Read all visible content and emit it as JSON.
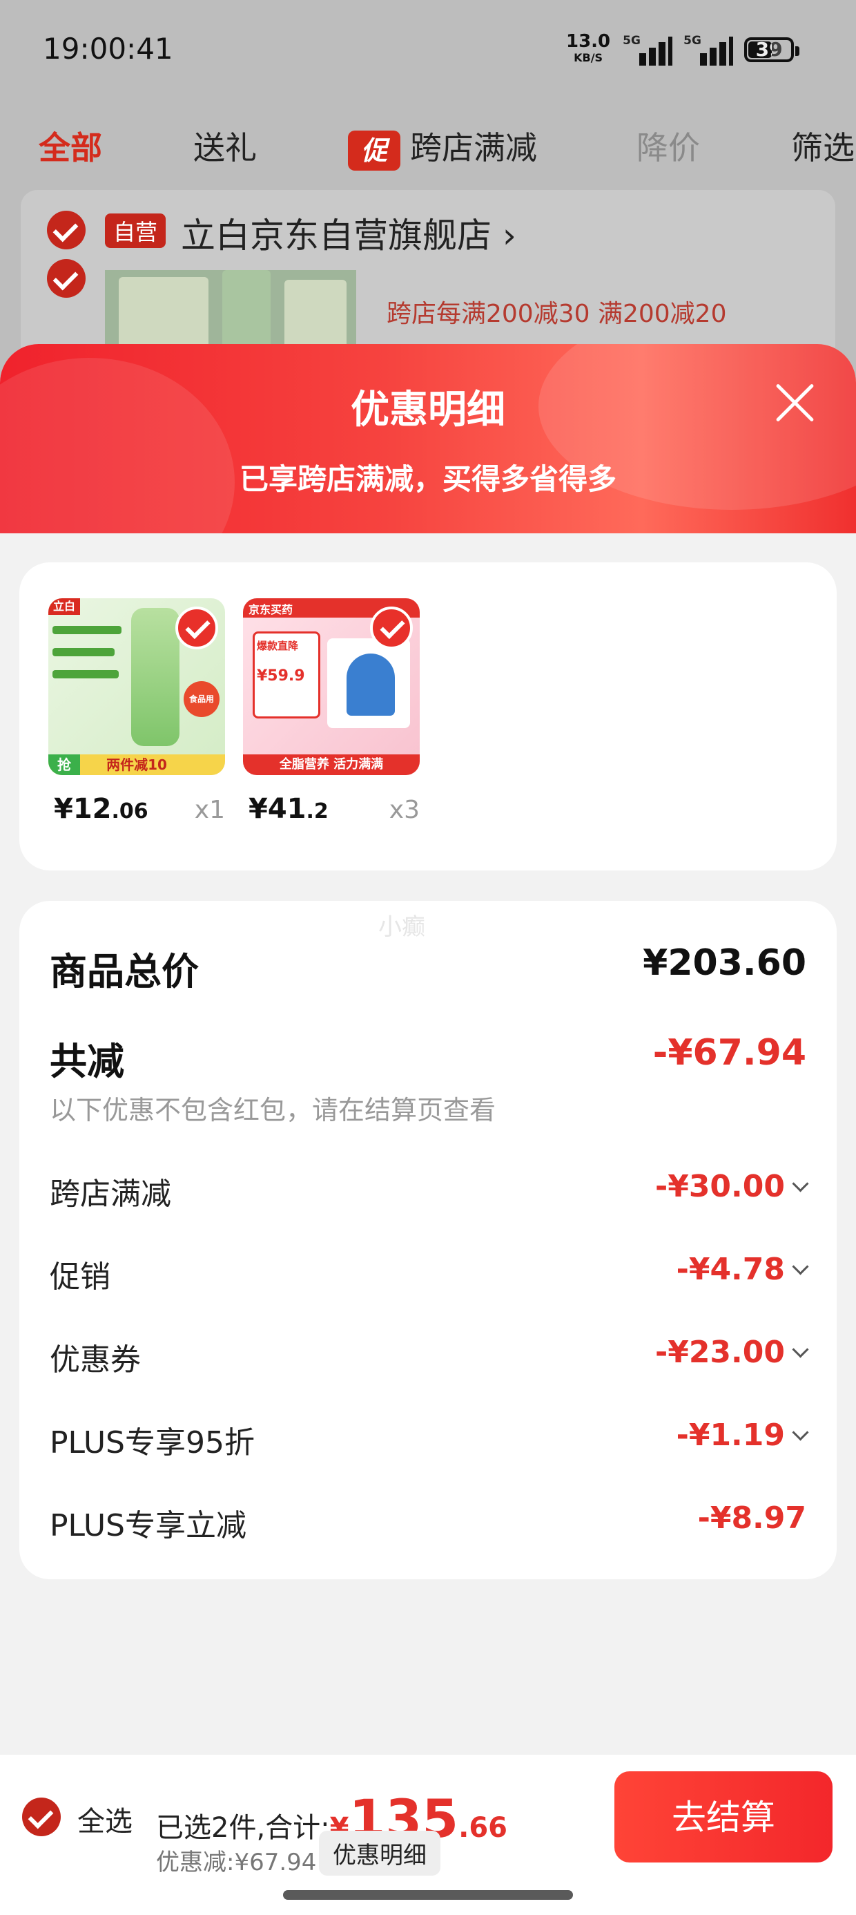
{
  "status_bar": {
    "time": "19:00:41",
    "net_speed": "13.0",
    "net_unit": "KB/S",
    "sig1": "5G",
    "sig2": "5G",
    "battery": "39"
  },
  "tabs": [
    {
      "label": "全部"
    },
    {
      "label": "送礼"
    },
    {
      "badge": "促",
      "label": "跨店满减"
    },
    {
      "label": "降价"
    },
    {
      "label": "筛选"
    }
  ],
  "store": {
    "self_tag": "自营",
    "name": "立白京东自营旗舰店",
    "chevron": "›",
    "promo_text": "跨店每满200减30  满200减20"
  },
  "sheet": {
    "title": "优惠明细",
    "subtitle": "已享跨店满减，买得多省得多",
    "products": [
      {
        "price_int": "¥12",
        "price_dec": ".06",
        "qty": "x1",
        "img_brand": "立白",
        "img_tag": "两件减10",
        "img_corner": "抢",
        "img_badge": "食品用"
      },
      {
        "price_int": "¥41",
        "price_dec": ".2",
        "qty": "x3",
        "img_brand": "京东买药",
        "img_tag": "全脂营养 活力满满",
        "img_promo": "爆款直降",
        "img_price": "¥59.9"
      }
    ],
    "watermark": "小癫",
    "total_label": "商品总价",
    "total_value": "¥203.60",
    "reduce_label": "共减",
    "reduce_value": "-¥67.94",
    "note": "以下优惠不包含红包，请在结算页查看",
    "items": [
      {
        "label": "跨店满减",
        "value": "-¥30.00"
      },
      {
        "label": "促销",
        "value": "-¥4.78"
      },
      {
        "label": "优惠券",
        "value": "-¥23.00"
      },
      {
        "label": "PLUS专享95折",
        "value": "-¥1.19"
      },
      {
        "label": "PLUS专享立减",
        "value": "-¥8.97"
      }
    ]
  },
  "bottom": {
    "select_all": "全选",
    "selected_text": "已选2件,合计:",
    "total_yen": "¥",
    "total_int": "135",
    "total_dec": ".66",
    "discount_text": "优惠减:¥67.94",
    "detail_button": "优惠明细",
    "checkout_button": "去结算"
  },
  "colors": {
    "accent": "#e4312b",
    "header_red": "#f0222c"
  }
}
